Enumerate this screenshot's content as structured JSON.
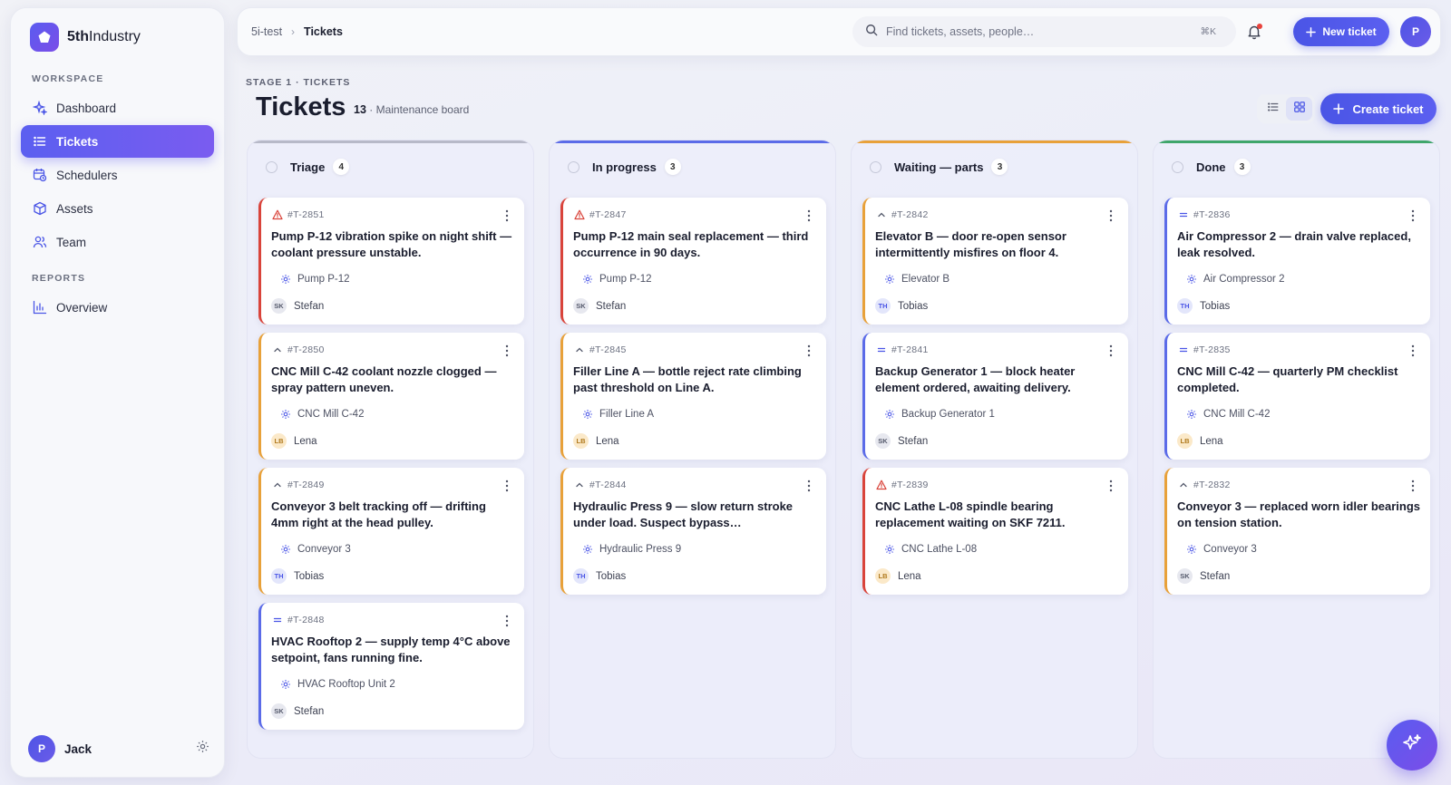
{
  "brand": {
    "name_bold": "5th",
    "name_rest": "Industry"
  },
  "sidebar": {
    "workspace_label": "WORKSPACE",
    "reports_label": "REPORTS",
    "items": [
      {
        "label": "Dashboard",
        "icon": "sparkle-icon"
      },
      {
        "label": "Tickets",
        "icon": "list-icon"
      },
      {
        "label": "Schedulers",
        "icon": "calendar-clock-icon"
      },
      {
        "label": "Assets",
        "icon": "cube-icon"
      },
      {
        "label": "Team",
        "icon": "users-icon"
      }
    ],
    "report_items": [
      {
        "label": "Overview",
        "icon": "bar-chart-icon"
      }
    ],
    "user": {
      "initial": "P",
      "name": "Jack"
    }
  },
  "topbar": {
    "breadcrumb": [
      "5i-test",
      "Tickets"
    ],
    "search_placeholder": "Find tickets, assets, people…",
    "search_shortcut": "⌘K",
    "new_ticket_label": "New ticket",
    "avatar_initial": "P"
  },
  "page": {
    "stage": "STAGE 1 · TICKETS",
    "title": "Tickets",
    "count": "13",
    "subtitle": "· Maintenance board",
    "create_label": "Create ticket"
  },
  "colors": {
    "accent": "#5b5ff0",
    "triage": "#b0b3c4",
    "in_progress": "#5b6be8",
    "waiting": "#e8a13a",
    "done": "#3fa66b",
    "priority_high": "#d9443b",
    "priority_medium": "#e8a13a",
    "priority_low": "#5b6be8"
  },
  "columns": [
    {
      "title": "Triage",
      "count": "4",
      "bar_color": "#b7b9c8",
      "cards": [
        {
          "id": "#T-2851",
          "priority": "high",
          "title": "Pump P-12 vibration spike on night shift — coolant pressure unstable.",
          "asset": "Pump P-12",
          "initials": "SK",
          "user": "Stefan"
        },
        {
          "id": "#T-2850",
          "priority": "medium",
          "title": "CNC Mill C-42 coolant nozzle clogged — spray pattern uneven.",
          "asset": "CNC Mill C-42",
          "initials": "LB",
          "user": "Lena"
        },
        {
          "id": "#T-2849",
          "priority": "medium",
          "title": "Conveyor 3 belt tracking off — drifting 4mm right at the head pulley.",
          "asset": "Conveyor 3",
          "initials": "TH",
          "user": "Tobias"
        },
        {
          "id": "#T-2848",
          "priority": "low",
          "title": "HVAC Rooftop 2 — supply temp 4°C above setpoint, fans running fine.",
          "asset": "HVAC Rooftop Unit 2",
          "initials": "SK",
          "user": "Stefan"
        }
      ]
    },
    {
      "title": "In progress",
      "count": "3",
      "bar_color": "#5b6be8",
      "cards": [
        {
          "id": "#T-2847",
          "priority": "high",
          "title": "Pump P-12 main seal replacement — third occurrence in 90 days.",
          "asset": "Pump P-12",
          "initials": "SK",
          "user": "Stefan"
        },
        {
          "id": "#T-2845",
          "priority": "medium",
          "title": "Filler Line A — bottle reject rate climbing past threshold on Line A.",
          "asset": "Filler Line A",
          "initials": "LB",
          "user": "Lena"
        },
        {
          "id": "#T-2844",
          "priority": "medium",
          "title": "Hydraulic Press 9 — slow return stroke under load. Suspect bypass…",
          "asset": "Hydraulic Press 9",
          "initials": "TH",
          "user": "Tobias"
        }
      ]
    },
    {
      "title": "Waiting — parts",
      "count": "3",
      "bar_color": "#e8a13a",
      "cards": [
        {
          "id": "#T-2842",
          "priority": "medium",
          "title": "Elevator B — door re-open sensor intermittently misfires on floor 4.",
          "asset": "Elevator B",
          "initials": "TH",
          "user": "Tobias"
        },
        {
          "id": "#T-2841",
          "priority": "low",
          "title": "Backup Generator 1 — block heater element ordered, awaiting delivery.",
          "asset": "Backup Generator 1",
          "initials": "SK",
          "user": "Stefan"
        },
        {
          "id": "#T-2839",
          "priority": "high",
          "title": "CNC Lathe L-08 spindle bearing replacement waiting on SKF 7211.",
          "asset": "CNC Lathe L-08",
          "initials": "LB",
          "user": "Lena"
        }
      ]
    },
    {
      "title": "Done",
      "count": "3",
      "bar_color": "#3fa66b",
      "cards": [
        {
          "id": "#T-2836",
          "priority": "low",
          "title": "Air Compressor 2 — drain valve replaced, leak resolved.",
          "asset": "Air Compressor 2",
          "initials": "TH",
          "user": "Tobias"
        },
        {
          "id": "#T-2835",
          "priority": "low",
          "title": "CNC Mill C-42 — quarterly PM checklist completed.",
          "asset": "CNC Mill C-42",
          "initials": "LB",
          "user": "Lena"
        },
        {
          "id": "#T-2832",
          "priority": "medium",
          "title": "Conveyor 3 — replaced worn idler bearings on tension station.",
          "asset": "Conveyor 3",
          "initials": "SK",
          "user": "Stefan"
        }
      ]
    }
  ]
}
